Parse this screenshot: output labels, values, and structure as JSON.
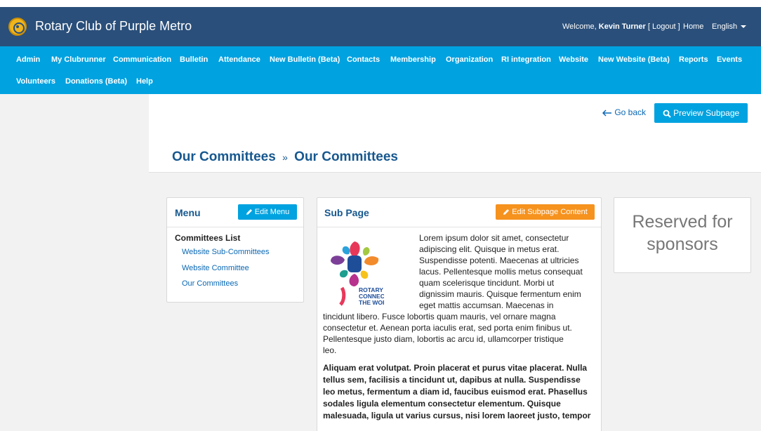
{
  "header": {
    "club_name": "Rotary Club of Purple Metro",
    "welcome_prefix": "Welcome, ",
    "user_name": "Kevin Turner",
    "logout": "[ Logout ]",
    "home": "Home",
    "language": "English"
  },
  "nav": {
    "row1": [
      "Admin",
      "My Clubrunner",
      "Communication",
      "Bulletin",
      "Attendance",
      "New Bulletin (Beta)",
      "Contacts",
      "Membership",
      "Organization",
      "RI integration",
      "Website",
      "New Website (Beta)",
      "Reports",
      "Events"
    ],
    "row2": [
      "Volunteers",
      "Donations (Beta)",
      "Help"
    ]
  },
  "actions": {
    "go_back": "Go back",
    "preview": "Preview Subpage"
  },
  "breadcrumb": {
    "parent": "Our Committees",
    "separator": "»",
    "current": "Our Committees"
  },
  "menu_card": {
    "title": "Menu",
    "edit_button": "Edit Menu",
    "list_title": "Committees List",
    "links": [
      "Website Sub-Committees",
      "Website Committee",
      "Our Committees"
    ]
  },
  "subpage_card": {
    "title": "Sub Page",
    "edit_button": "Edit Subpage Content",
    "logo_text": [
      "ROTARY",
      "CONNECTS",
      "THE WORLD"
    ],
    "para1_wrapped": [
      "Lorem ipsum dolor sit amet, consectetur",
      "adipiscing elit. Quisque in metus erat.",
      "Suspendisse potenti. Maecenas at ultricies",
      "lacus. Pellentesque mollis metus consequat",
      "quam scelerisque tincidunt. Morbi ut",
      "dignissim mauris. Quisque fermentum enim",
      "eget mattis accumsan. Maecenas in"
    ],
    "para1_full": [
      "tincidunt libero. Fusce lobortis quam mauris, vel ornare magna",
      "consectetur et. Aenean porta iaculis erat, sed porta enim finibus ut.",
      "Pellentesque justo diam, lobortis ac arcu id, ullamcorper tristique",
      "leo."
    ],
    "para2": [
      "Aliquam erat volutpat. Proin placerat et purus vitae placerat. Nulla",
      "tellus sem, facilisis a tincidunt ut, dapibus at nulla. Suspendisse",
      "leo metus, fermentum a diam id, faucibus euismod erat. Phasellus",
      "sodales ligula elementum consectetur elementum. Quisque",
      "malesuada, ligula ut varius cursus, nisi lorem laoreet justo, tempor"
    ]
  },
  "sponsor_card": {
    "line1": "Reserved for",
    "line2": "sponsors"
  },
  "colors": {
    "header_bg": "#2a4f7a",
    "nav_bg": "#00a2e0",
    "primary_button": "#00a2e0",
    "orange_button": "#f6921e",
    "title_blue": "#17588f"
  }
}
